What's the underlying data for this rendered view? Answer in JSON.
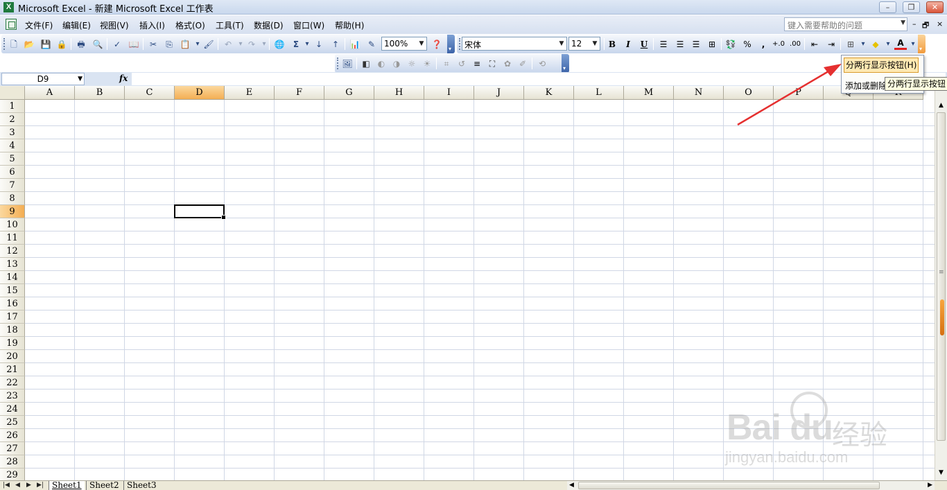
{
  "window": {
    "title": "Microsoft Excel - 新建 Microsoft Excel 工作表",
    "minimize": "–",
    "restore": "❐",
    "close": "✕"
  },
  "menubar": {
    "items": [
      "文件(F)",
      "编辑(E)",
      "视图(V)",
      "插入(I)",
      "格式(O)",
      "工具(T)",
      "数据(D)",
      "窗口(W)",
      "帮助(H)"
    ],
    "help_placeholder": "键入需要帮助的问题",
    "doc_minimize": "–",
    "doc_restore": "🗗",
    "doc_close": "×"
  },
  "standard_toolbar": {
    "zoom": "100%"
  },
  "formatting_toolbar": {
    "font": "宋体",
    "size": "12",
    "bold": "B",
    "italic": "I",
    "underline": "U",
    "percent": "%",
    "comma": ",",
    "font_color_label": "A"
  },
  "formula_bar": {
    "name_box": "D9",
    "fx": "fx",
    "formula": ""
  },
  "grid": {
    "columns": [
      "A",
      "B",
      "C",
      "D",
      "E",
      "F",
      "G",
      "H",
      "I",
      "J",
      "K",
      "L",
      "M",
      "N",
      "O",
      "P",
      "Q",
      "R"
    ],
    "rows": [
      "1",
      "2",
      "3",
      "4",
      "5",
      "6",
      "7",
      "8",
      "9",
      "10",
      "11",
      "12",
      "13",
      "14",
      "15",
      "16",
      "17",
      "18",
      "19",
      "20",
      "21",
      "22",
      "23",
      "24",
      "25",
      "26",
      "27",
      "28",
      "29"
    ],
    "active_cell": "D9",
    "active_column": "D",
    "active_row": "9"
  },
  "sheets": {
    "tabs": [
      "Sheet1",
      "Sheet2",
      "Sheet3"
    ],
    "active": "Sheet1"
  },
  "toolbar_options_dropdown": {
    "item1": "分两行显示按钮(H)",
    "item2": "添加或删除"
  },
  "tooltip": {
    "text": "分两行显示按钮"
  },
  "watermark": {
    "brand": "Bai du",
    "cn": "经验",
    "url": "jingyan.baidu.com"
  },
  "colors": {
    "annotation_arrow": "#e53030",
    "active_header": "#f4ae53"
  }
}
